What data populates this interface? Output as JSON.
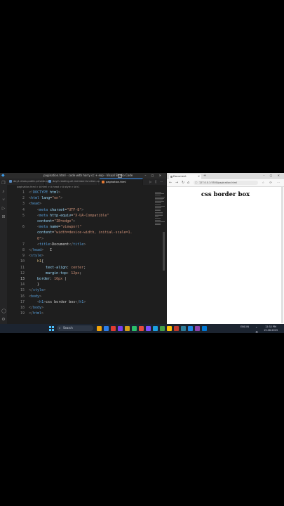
{
  "vscode": {
    "title": "pagination.html - code with harry cc + exp - Visual Studio Code",
    "tabs": [
      {
        "label": "day1-draw-public-private.cpp",
        "color": "#5a8bbf"
      },
      {
        "label": "day2-reading-all-member-function.cpp",
        "color": "#5a8bbf"
      },
      {
        "label": "pagination.html",
        "color": "#e37933",
        "active": true
      }
    ],
    "breadcrumb": "pagination.html > ⧉ html > ⧉ head > ⧉ style > ⧉ h1",
    "lines": [
      {
        "n": "1",
        "parts": [
          [
            "punc",
            "<!"
          ],
          [
            "tag",
            "DOCTYPE"
          ],
          [
            "attr",
            " html"
          ],
          [
            "punc",
            ">"
          ]
        ]
      },
      {
        "n": "2",
        "parts": [
          [
            "punc",
            "<"
          ],
          [
            "tag",
            "html"
          ],
          [
            "attr",
            " lang"
          ],
          [
            "txt",
            "="
          ],
          [
            "str",
            "\"en\""
          ],
          [
            "punc",
            ">"
          ]
        ]
      },
      {
        "n": "3",
        "parts": [
          [
            "punc",
            "<"
          ],
          [
            "tag",
            "head"
          ],
          [
            "punc",
            ">"
          ]
        ]
      },
      {
        "n": "4",
        "parts": [
          [
            "txt",
            "    "
          ],
          [
            "punc",
            "<"
          ],
          [
            "tag",
            "meta"
          ],
          [
            "attr",
            " charset"
          ],
          [
            "txt",
            "="
          ],
          [
            "str",
            "\"UTF-8\""
          ],
          [
            "punc",
            ">"
          ]
        ]
      },
      {
        "n": "5",
        "parts": [
          [
            "txt",
            "    "
          ],
          [
            "punc",
            "<"
          ],
          [
            "tag",
            "meta"
          ],
          [
            "attr",
            " http-equiv"
          ],
          [
            "txt",
            "="
          ],
          [
            "str",
            "\"X-UA-Compatible\""
          ]
        ]
      },
      {
        "n": "",
        "parts": [
          [
            "txt",
            "    "
          ],
          [
            "attr",
            "content"
          ],
          [
            "txt",
            "="
          ],
          [
            "str",
            "\"IE=edge\""
          ],
          [
            "punc",
            ">"
          ]
        ]
      },
      {
        "n": "6",
        "parts": [
          [
            "txt",
            "    "
          ],
          [
            "punc",
            "<"
          ],
          [
            "tag",
            "meta"
          ],
          [
            "attr",
            " name"
          ],
          [
            "txt",
            "="
          ],
          [
            "str",
            "\"viewport\""
          ]
        ]
      },
      {
        "n": "",
        "parts": [
          [
            "txt",
            "    "
          ],
          [
            "attr",
            "content"
          ],
          [
            "txt",
            "="
          ],
          [
            "str",
            "\"width=device-width, initial-scale=1."
          ]
        ]
      },
      {
        "n": "",
        "parts": [
          [
            "txt",
            "    "
          ],
          [
            "str",
            "0\""
          ],
          [
            "punc",
            ">"
          ]
        ]
      },
      {
        "n": "7",
        "parts": [
          [
            "txt",
            "    "
          ],
          [
            "punc",
            "<"
          ],
          [
            "tag",
            "title"
          ],
          [
            "punc",
            ">"
          ],
          [
            "txt",
            "Document"
          ],
          [
            "punc",
            "</"
          ],
          [
            "tag",
            "title"
          ],
          [
            "punc",
            ">"
          ]
        ]
      },
      {
        "n": "8",
        "parts": [
          [
            "punc",
            "</"
          ],
          [
            "tag",
            "head"
          ],
          [
            "punc",
            ">"
          ],
          [
            "txt",
            "   I"
          ]
        ]
      },
      {
        "n": "9",
        "parts": [
          [
            "punc",
            "<"
          ],
          [
            "tag",
            "style"
          ],
          [
            "punc",
            ">"
          ]
        ]
      },
      {
        "n": "10",
        "parts": [
          [
            "txt",
            "    "
          ],
          [
            "sel",
            "h1"
          ],
          [
            "txt",
            "{"
          ]
        ]
      },
      {
        "n": "11",
        "parts": [
          [
            "txt",
            "        "
          ],
          [
            "prop",
            "text-align"
          ],
          [
            "txt",
            ": "
          ],
          [
            "val",
            "center"
          ],
          [
            "txt",
            ";"
          ]
        ]
      },
      {
        "n": "12",
        "parts": [
          [
            "txt",
            "        "
          ],
          [
            "prop",
            "margin-top"
          ],
          [
            "txt",
            ": "
          ],
          [
            "val",
            "12px"
          ],
          [
            "txt",
            ";"
          ]
        ]
      },
      {
        "n": "13",
        "cur": true,
        "parts": [
          [
            "txt",
            "    "
          ],
          [
            "prop",
            "border"
          ],
          [
            "txt",
            ": "
          ],
          [
            "val",
            "16px"
          ],
          [
            "txt",
            " |"
          ]
        ]
      },
      {
        "n": "14",
        "parts": [
          [
            "txt",
            "    }"
          ]
        ]
      },
      {
        "n": "15",
        "parts": [
          [
            "punc",
            "</"
          ],
          [
            "tag",
            "style"
          ],
          [
            "punc",
            ">"
          ]
        ]
      },
      {
        "n": "16",
        "parts": [
          [
            "punc",
            "<"
          ],
          [
            "tag",
            "body"
          ],
          [
            "punc",
            ">"
          ]
        ]
      },
      {
        "n": "17",
        "parts": [
          [
            "txt",
            "    "
          ],
          [
            "punc",
            "<"
          ],
          [
            "tag",
            "h1"
          ],
          [
            "punc",
            ">"
          ],
          [
            "txt",
            "css border box"
          ],
          [
            "punc",
            "</"
          ],
          [
            "tag",
            "h1"
          ],
          [
            "punc",
            ">"
          ]
        ]
      },
      {
        "n": "18",
        "parts": [
          [
            "punc",
            "</"
          ],
          [
            "tag",
            "body"
          ],
          [
            "punc",
            ">"
          ]
        ]
      },
      {
        "n": "19",
        "parts": [
          [
            "punc",
            "</"
          ],
          [
            "tag",
            "html"
          ],
          [
            "punc",
            ">"
          ]
        ]
      }
    ]
  },
  "browser": {
    "tab_title": "Document",
    "url": "127.0.0.1:5500/pagination.html",
    "h1": "css border box"
  },
  "taskbar": {
    "search": "Search",
    "lang": "ENG IN",
    "time": "12:32 PM",
    "date": "19-06-2023",
    "apps": [
      "#f0a30a",
      "#2b7de9",
      "#e03c31",
      "#7a3df0",
      "#d4a017",
      "#2bbf6a",
      "#e74c3c",
      "#7c4dff",
      "#1ba1e2",
      "#43a047",
      "#ffc107",
      "#c0392b",
      "#2d7d9a",
      "#1e88e5",
      "#8e44ad",
      "#0078d4"
    ]
  }
}
